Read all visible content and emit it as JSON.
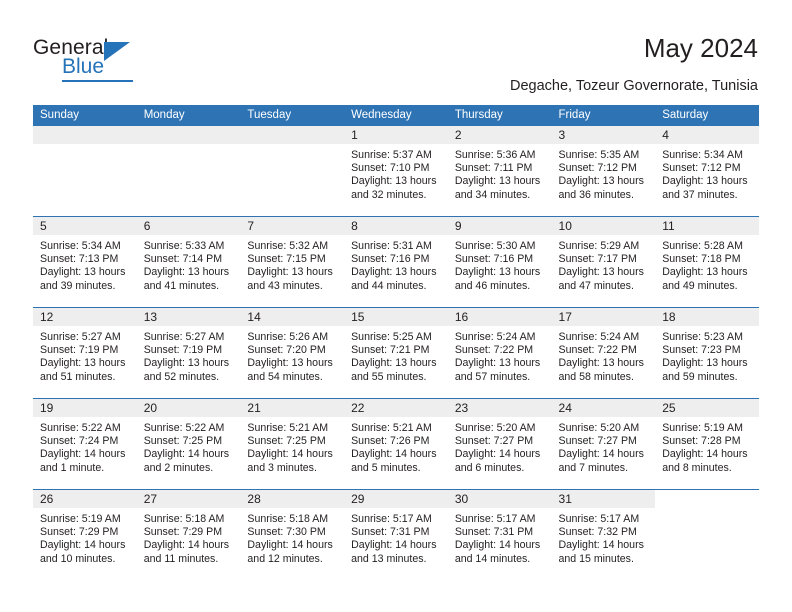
{
  "brand": {
    "name_part1": "General",
    "name_part2": "Blue",
    "accent_color": "#2573b8"
  },
  "header": {
    "title": "May 2024",
    "subtitle": "Degache, Tozeur Governorate, Tunisia"
  },
  "calendar": {
    "header_color": "#2e74b5",
    "day_names": [
      "Sunday",
      "Monday",
      "Tuesday",
      "Wednesday",
      "Thursday",
      "Friday",
      "Saturday"
    ],
    "weeks": [
      [
        {
          "day": "",
          "sunrise": "",
          "sunset": "",
          "daylight1": "",
          "daylight2": ""
        },
        {
          "day": "",
          "sunrise": "",
          "sunset": "",
          "daylight1": "",
          "daylight2": ""
        },
        {
          "day": "",
          "sunrise": "",
          "sunset": "",
          "daylight1": "",
          "daylight2": ""
        },
        {
          "day": "1",
          "sunrise": "Sunrise: 5:37 AM",
          "sunset": "Sunset: 7:10 PM",
          "daylight1": "Daylight: 13 hours",
          "daylight2": "and 32 minutes."
        },
        {
          "day": "2",
          "sunrise": "Sunrise: 5:36 AM",
          "sunset": "Sunset: 7:11 PM",
          "daylight1": "Daylight: 13 hours",
          "daylight2": "and 34 minutes."
        },
        {
          "day": "3",
          "sunrise": "Sunrise: 5:35 AM",
          "sunset": "Sunset: 7:12 PM",
          "daylight1": "Daylight: 13 hours",
          "daylight2": "and 36 minutes."
        },
        {
          "day": "4",
          "sunrise": "Sunrise: 5:34 AM",
          "sunset": "Sunset: 7:12 PM",
          "daylight1": "Daylight: 13 hours",
          "daylight2": "and 37 minutes."
        }
      ],
      [
        {
          "day": "5",
          "sunrise": "Sunrise: 5:34 AM",
          "sunset": "Sunset: 7:13 PM",
          "daylight1": "Daylight: 13 hours",
          "daylight2": "and 39 minutes."
        },
        {
          "day": "6",
          "sunrise": "Sunrise: 5:33 AM",
          "sunset": "Sunset: 7:14 PM",
          "daylight1": "Daylight: 13 hours",
          "daylight2": "and 41 minutes."
        },
        {
          "day": "7",
          "sunrise": "Sunrise: 5:32 AM",
          "sunset": "Sunset: 7:15 PM",
          "daylight1": "Daylight: 13 hours",
          "daylight2": "and 43 minutes."
        },
        {
          "day": "8",
          "sunrise": "Sunrise: 5:31 AM",
          "sunset": "Sunset: 7:16 PM",
          "daylight1": "Daylight: 13 hours",
          "daylight2": "and 44 minutes."
        },
        {
          "day": "9",
          "sunrise": "Sunrise: 5:30 AM",
          "sunset": "Sunset: 7:16 PM",
          "daylight1": "Daylight: 13 hours",
          "daylight2": "and 46 minutes."
        },
        {
          "day": "10",
          "sunrise": "Sunrise: 5:29 AM",
          "sunset": "Sunset: 7:17 PM",
          "daylight1": "Daylight: 13 hours",
          "daylight2": "and 47 minutes."
        },
        {
          "day": "11",
          "sunrise": "Sunrise: 5:28 AM",
          "sunset": "Sunset: 7:18 PM",
          "daylight1": "Daylight: 13 hours",
          "daylight2": "and 49 minutes."
        }
      ],
      [
        {
          "day": "12",
          "sunrise": "Sunrise: 5:27 AM",
          "sunset": "Sunset: 7:19 PM",
          "daylight1": "Daylight: 13 hours",
          "daylight2": "and 51 minutes."
        },
        {
          "day": "13",
          "sunrise": "Sunrise: 5:27 AM",
          "sunset": "Sunset: 7:19 PM",
          "daylight1": "Daylight: 13 hours",
          "daylight2": "and 52 minutes."
        },
        {
          "day": "14",
          "sunrise": "Sunrise: 5:26 AM",
          "sunset": "Sunset: 7:20 PM",
          "daylight1": "Daylight: 13 hours",
          "daylight2": "and 54 minutes."
        },
        {
          "day": "15",
          "sunrise": "Sunrise: 5:25 AM",
          "sunset": "Sunset: 7:21 PM",
          "daylight1": "Daylight: 13 hours",
          "daylight2": "and 55 minutes."
        },
        {
          "day": "16",
          "sunrise": "Sunrise: 5:24 AM",
          "sunset": "Sunset: 7:22 PM",
          "daylight1": "Daylight: 13 hours",
          "daylight2": "and 57 minutes."
        },
        {
          "day": "17",
          "sunrise": "Sunrise: 5:24 AM",
          "sunset": "Sunset: 7:22 PM",
          "daylight1": "Daylight: 13 hours",
          "daylight2": "and 58 minutes."
        },
        {
          "day": "18",
          "sunrise": "Sunrise: 5:23 AM",
          "sunset": "Sunset: 7:23 PM",
          "daylight1": "Daylight: 13 hours",
          "daylight2": "and 59 minutes."
        }
      ],
      [
        {
          "day": "19",
          "sunrise": "Sunrise: 5:22 AM",
          "sunset": "Sunset: 7:24 PM",
          "daylight1": "Daylight: 14 hours",
          "daylight2": "and 1 minute."
        },
        {
          "day": "20",
          "sunrise": "Sunrise: 5:22 AM",
          "sunset": "Sunset: 7:25 PM",
          "daylight1": "Daylight: 14 hours",
          "daylight2": "and 2 minutes."
        },
        {
          "day": "21",
          "sunrise": "Sunrise: 5:21 AM",
          "sunset": "Sunset: 7:25 PM",
          "daylight1": "Daylight: 14 hours",
          "daylight2": "and 3 minutes."
        },
        {
          "day": "22",
          "sunrise": "Sunrise: 5:21 AM",
          "sunset": "Sunset: 7:26 PM",
          "daylight1": "Daylight: 14 hours",
          "daylight2": "and 5 minutes."
        },
        {
          "day": "23",
          "sunrise": "Sunrise: 5:20 AM",
          "sunset": "Sunset: 7:27 PM",
          "daylight1": "Daylight: 14 hours",
          "daylight2": "and 6 minutes."
        },
        {
          "day": "24",
          "sunrise": "Sunrise: 5:20 AM",
          "sunset": "Sunset: 7:27 PM",
          "daylight1": "Daylight: 14 hours",
          "daylight2": "and 7 minutes."
        },
        {
          "day": "25",
          "sunrise": "Sunrise: 5:19 AM",
          "sunset": "Sunset: 7:28 PM",
          "daylight1": "Daylight: 14 hours",
          "daylight2": "and 8 minutes."
        }
      ],
      [
        {
          "day": "26",
          "sunrise": "Sunrise: 5:19 AM",
          "sunset": "Sunset: 7:29 PM",
          "daylight1": "Daylight: 14 hours",
          "daylight2": "and 10 minutes."
        },
        {
          "day": "27",
          "sunrise": "Sunrise: 5:18 AM",
          "sunset": "Sunset: 7:29 PM",
          "daylight1": "Daylight: 14 hours",
          "daylight2": "and 11 minutes."
        },
        {
          "day": "28",
          "sunrise": "Sunrise: 5:18 AM",
          "sunset": "Sunset: 7:30 PM",
          "daylight1": "Daylight: 14 hours",
          "daylight2": "and 12 minutes."
        },
        {
          "day": "29",
          "sunrise": "Sunrise: 5:17 AM",
          "sunset": "Sunset: 7:31 PM",
          "daylight1": "Daylight: 14 hours",
          "daylight2": "and 13 minutes."
        },
        {
          "day": "30",
          "sunrise": "Sunrise: 5:17 AM",
          "sunset": "Sunset: 7:31 PM",
          "daylight1": "Daylight: 14 hours",
          "daylight2": "and 14 minutes."
        },
        {
          "day": "31",
          "sunrise": "Sunrise: 5:17 AM",
          "sunset": "Sunset: 7:32 PM",
          "daylight1": "Daylight: 14 hours",
          "daylight2": "and 15 minutes."
        },
        {
          "day": "",
          "sunrise": "",
          "sunset": "",
          "daylight1": "",
          "daylight2": ""
        }
      ]
    ]
  }
}
